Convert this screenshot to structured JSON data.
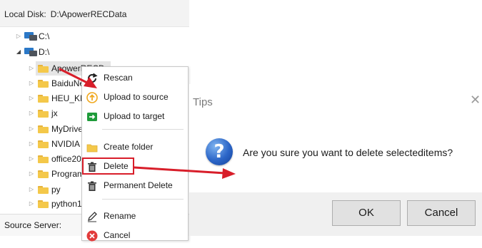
{
  "explorer": {
    "path_label": "Local Disk:",
    "path_value": "D:\\ApowerRECData",
    "tree": [
      {
        "label": "C:\\",
        "kind": "drive",
        "expanded": false
      },
      {
        "label": "D:\\",
        "kind": "drive",
        "expanded": true
      },
      {
        "label": "ApowerRECD",
        "kind": "folder"
      },
      {
        "label": "BaiduNe",
        "kind": "folder"
      },
      {
        "label": "HEU_KM",
        "kind": "folder"
      },
      {
        "label": "jx",
        "kind": "folder"
      },
      {
        "label": "MyDrive",
        "kind": "folder"
      },
      {
        "label": "NVIDIA",
        "kind": "folder"
      },
      {
        "label": "office20",
        "kind": "folder"
      },
      {
        "label": "Program",
        "kind": "folder"
      },
      {
        "label": "py",
        "kind": "folder"
      },
      {
        "label": "python1",
        "kind": "folder"
      }
    ],
    "source_label": "Source Server:"
  },
  "context_menu": {
    "items": [
      {
        "label": "Rescan",
        "icon": "refresh-icon"
      },
      {
        "label": "Upload to source",
        "icon": "upload-source-icon"
      },
      {
        "label": "Upload to target",
        "icon": "upload-target-icon"
      },
      {
        "label": "Create folder",
        "icon": "folder-icon"
      },
      {
        "label": "Delete",
        "icon": "trash-icon"
      },
      {
        "label": "Permanent Delete",
        "icon": "trash-icon"
      },
      {
        "label": "Rename",
        "icon": "pencil-icon"
      },
      {
        "label": "Cancel",
        "icon": "cancel-icon"
      }
    ]
  },
  "dialog": {
    "title": "Tips",
    "close_glyph": "✕",
    "icon_glyph": "?",
    "message": "Are you sure you want to delete selecteditems?",
    "ok_label": "OK",
    "cancel_label": "Cancel"
  },
  "colors": {
    "annotation_red": "#d81e2a",
    "folder_yellow": "#f4c84a",
    "upload_source_orange": "#f0a81e",
    "upload_target_green": "#1f9b3a"
  }
}
